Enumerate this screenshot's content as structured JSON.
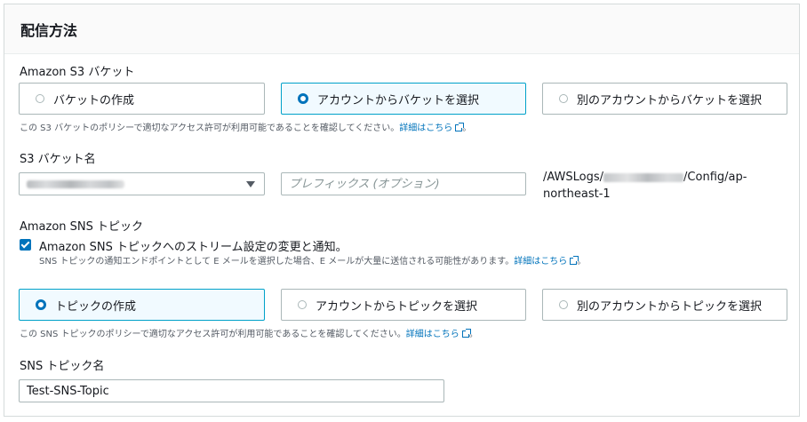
{
  "header": {
    "title": "配信方法"
  },
  "s3": {
    "label": "Amazon S3 バケット",
    "options": [
      {
        "label": "バケットの作成",
        "selected": false
      },
      {
        "label": "アカウントからバケットを選択",
        "selected": true
      },
      {
        "label": "別のアカウントからバケットを選択",
        "selected": false
      }
    ],
    "hint": "この S3 バケットのポリシーで適切なアクセス許可が利用可能であることを確認してください。",
    "hint_link": "詳細はこちら",
    "hint_suffix": "。"
  },
  "bucket": {
    "label": "S3 バケット名",
    "prefix_placeholder": "プレフィックス (オプション)",
    "path_prefix": "/AWSLogs/",
    "path_suffix": "/Config/ap-northeast-1"
  },
  "sns": {
    "label": "Amazon SNS トピック",
    "checkbox_label": "Amazon SNS トピックへのストリーム設定の変更と通知。",
    "checkbox_checked": true,
    "checkbox_hint": "SNS トピックの通知エンドポイントとして E メールを選択した場合、E メールが大量に送信される可能性があります。",
    "checkbox_hint_link": "詳細はこちら",
    "checkbox_hint_suffix": "。",
    "options": [
      {
        "label": "トピックの作成",
        "selected": true
      },
      {
        "label": "アカウントからトピックを選択",
        "selected": false
      },
      {
        "label": "別のアカウントからトピックを選択",
        "selected": false
      }
    ],
    "hint": "この SNS トピックのポリシーで適切なアクセス許可が利用可能であることを確認してください。",
    "hint_link": "詳細はこちら",
    "hint_suffix": "。"
  },
  "topic": {
    "label": "SNS トピック名",
    "value": "Test-SNS-Topic"
  },
  "colors": {
    "accent": "#0073bb",
    "selected_border": "#00a1c9",
    "selected_bg": "#f1faff"
  }
}
